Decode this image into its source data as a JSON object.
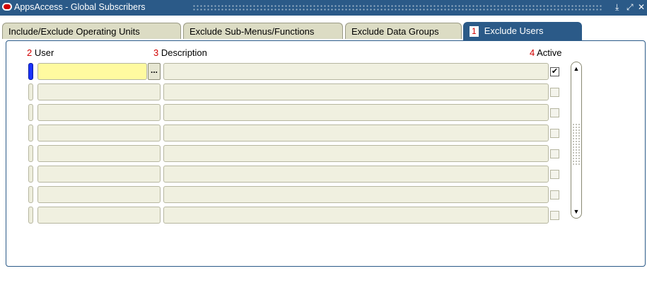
{
  "window": {
    "title": "AppsAccess - Global Subscribers",
    "controls": [
      "minimize-icon",
      "maximize-icon",
      "close-icon"
    ]
  },
  "tabs": [
    {
      "label": "Include/Exclude Operating Units",
      "active": false
    },
    {
      "label": "Exclude Sub-Menus/Functions",
      "active": false
    },
    {
      "label": "Exclude Data Groups",
      "active": false
    },
    {
      "label": "Exclude Users",
      "active": true,
      "number": "1"
    }
  ],
  "columns": {
    "user": {
      "num": "2",
      "label": "User"
    },
    "description": {
      "num": "3",
      "label": "Description"
    },
    "active": {
      "num": "4",
      "label": "Active"
    }
  },
  "rows": [
    {
      "user": "",
      "description": "",
      "active": true,
      "current": true
    },
    {
      "user": "",
      "description": "",
      "active": false
    },
    {
      "user": "",
      "description": "",
      "active": false
    },
    {
      "user": "",
      "description": "",
      "active": false
    },
    {
      "user": "",
      "description": "",
      "active": false
    },
    {
      "user": "",
      "description": "",
      "active": false
    },
    {
      "user": "",
      "description": "",
      "active": false
    },
    {
      "user": "",
      "description": "",
      "active": false
    }
  ],
  "lov_button_label": "...",
  "check_mark": "✔",
  "colors": {
    "titlebar": "#2b5a88",
    "current_field": "#fffaa0",
    "record_indicator": "#1a33ff",
    "field_bg": "#f0f0e0",
    "number_red": "#d10000"
  }
}
